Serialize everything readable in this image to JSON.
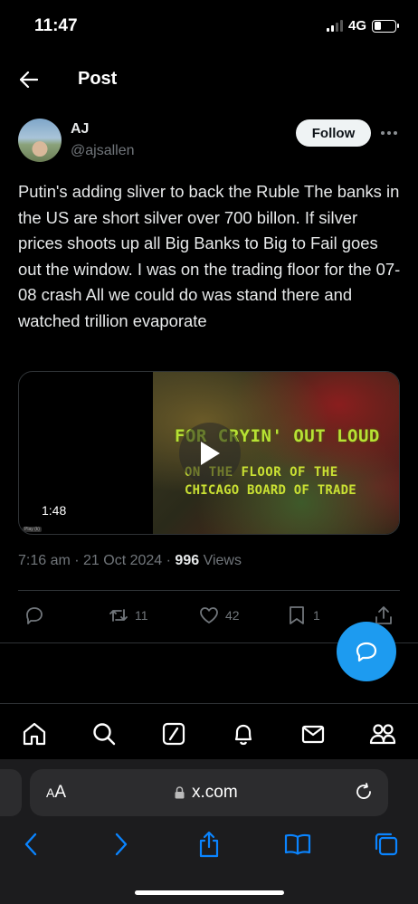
{
  "status": {
    "time": "11:47",
    "network": "4G"
  },
  "header": {
    "title": "Post",
    "back_icon": "arrow-left-icon"
  },
  "author": {
    "name": "AJ",
    "handle": "@ajsallen",
    "follow_label": "Follow"
  },
  "post": {
    "text": "Putin's adding sliver to back the Ruble The banks in the US are short silver over 700 billon. If silver prices shoots up all Big Banks to Big to Fail goes out the window. I was on the trading floor for the 07-08 crash All we could do was stand there and watched trillion evaporate",
    "video": {
      "duration": "1:48",
      "caption_line1": "FOR CRYIN' OUT LOUD",
      "caption_line2": "ON THE FLOOR OF THE",
      "caption_line3": "CHICAGO BOARD OF TRADE",
      "tag": "Play (k)"
    },
    "timestamp": "7:16 am · 21 Oct 2024 · ",
    "views_count": "996",
    "views_label": " Views"
  },
  "actions": {
    "reply_count": "",
    "retweet_count": "11",
    "like_count": "42",
    "bookmark_count": "1"
  },
  "tabs": [
    "home-icon",
    "search-icon",
    "grok-icon",
    "notifications-icon",
    "messages-icon",
    "communities-icon"
  ],
  "browser": {
    "aa_label_big": "A",
    "aa_label_small": "A",
    "url": "x.com"
  },
  "colors": {
    "accent": "#1d9bf0",
    "muted": "#71767b",
    "text": "#e7e9ea",
    "caption": "#b7e234"
  }
}
